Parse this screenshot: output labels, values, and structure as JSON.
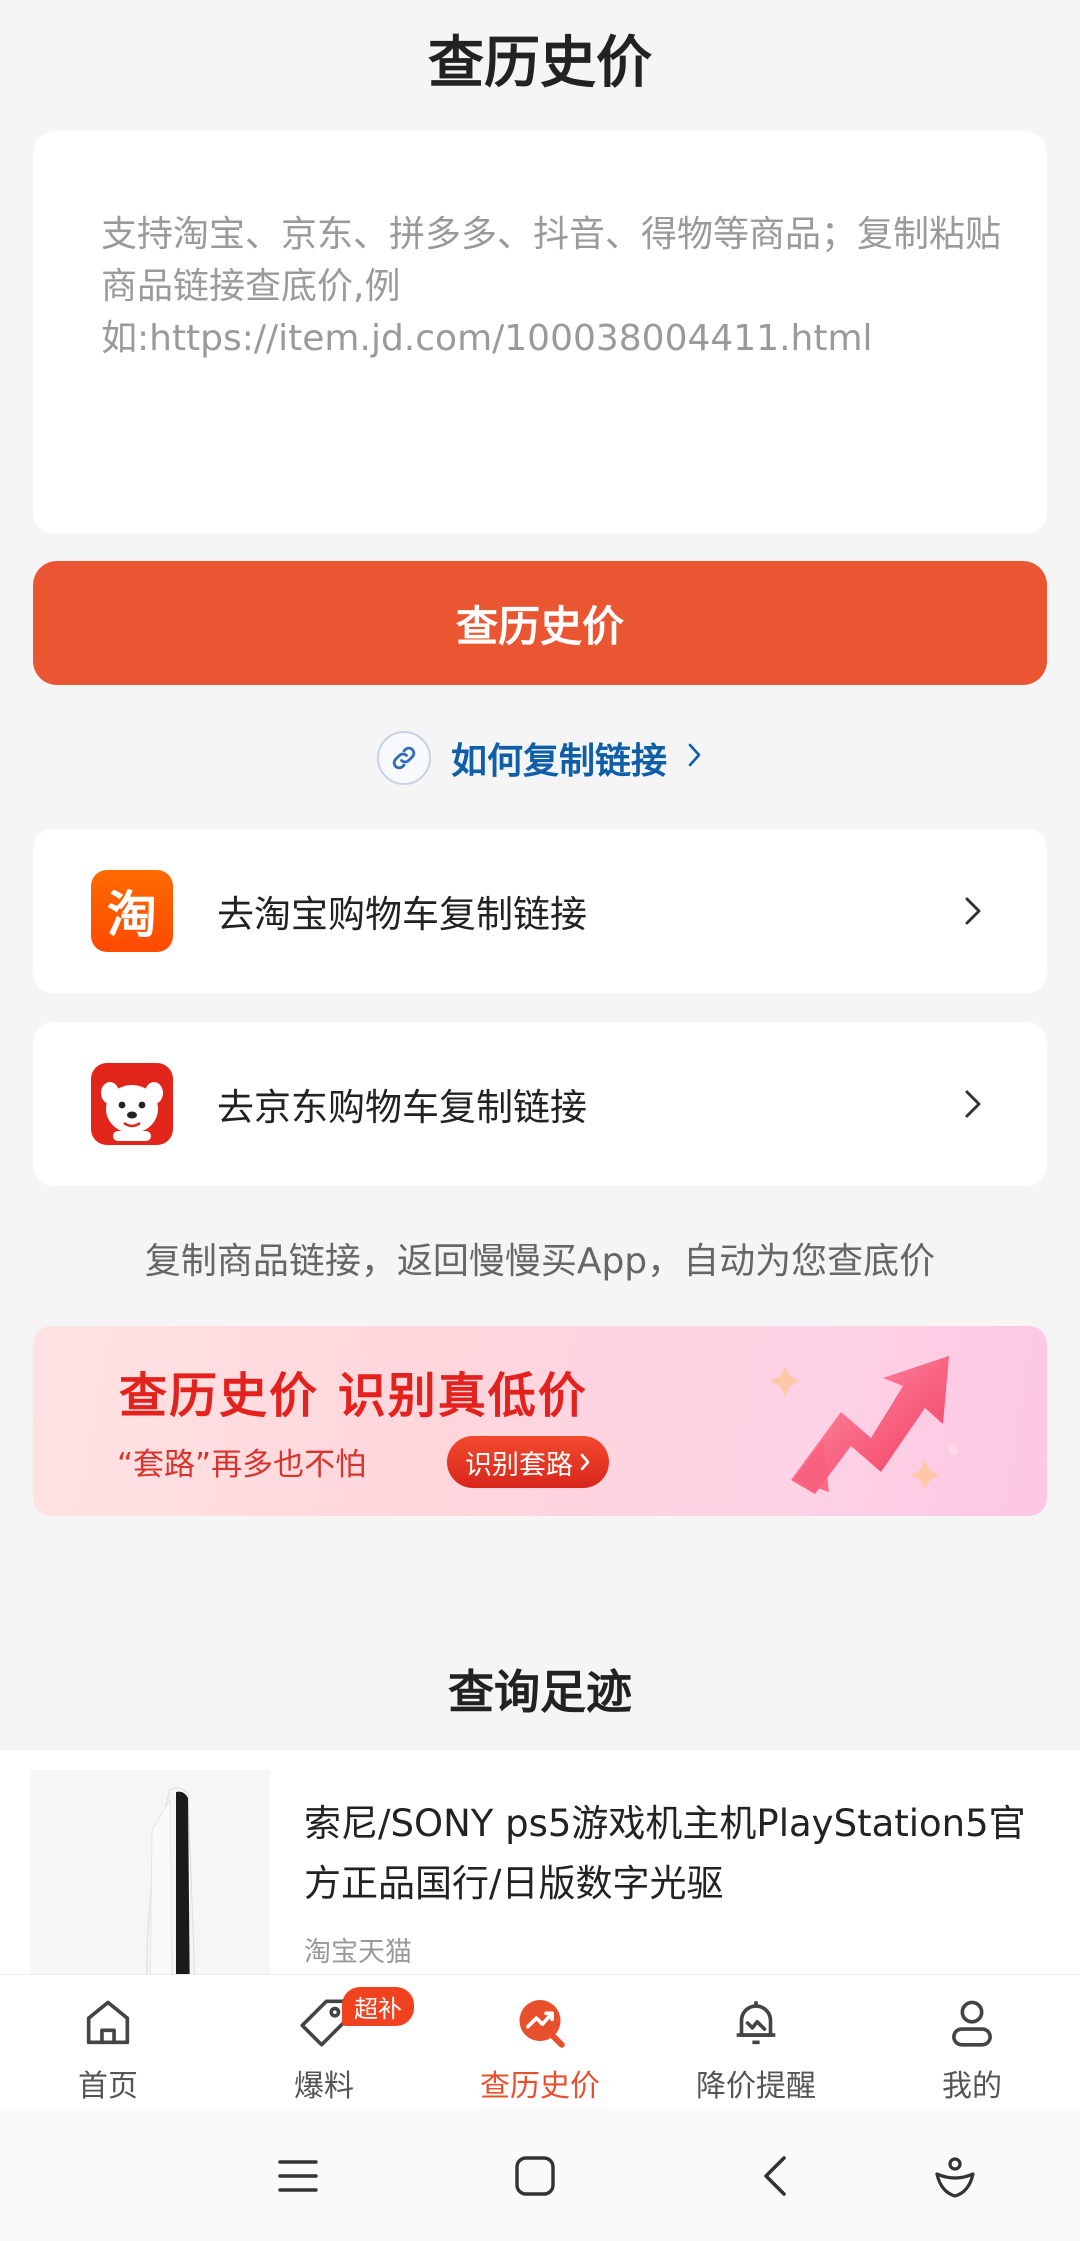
{
  "header": {
    "title": "查历史价"
  },
  "link_input": {
    "placeholder": "支持淘宝、京东、拼多多、抖音、得物等商品；复制粘贴商品链接查底价,例如:https://item.jd.com/100038004411.html"
  },
  "search_button": {
    "label": "查历史价"
  },
  "howto": {
    "label": "如何复制链接",
    "icon": "link-icon"
  },
  "shops": [
    {
      "logo_text": "淘",
      "label": "去淘宝购物车复制链接",
      "brand_color": "#ff5a00"
    },
    {
      "label": "去京东购物车复制链接",
      "brand_color": "#e1251b"
    }
  ],
  "hint": "复制商品链接，返回慢慢买App，自动为您查底价",
  "banner": {
    "title": "查历史价  识别真低价",
    "subtitle": "“套路”再多也不怕",
    "button_label": "识别套路"
  },
  "history": {
    "title": "查询足迹",
    "items": [
      {
        "name": "索尼/SONY ps5游戏机主机PlayStation5官方正品国行/日版数字光驱",
        "source": "淘宝天猫"
      }
    ]
  },
  "tabbar": {
    "items": [
      {
        "label": "首页",
        "icon": "home-icon"
      },
      {
        "label": "爆料",
        "icon": "tag-icon",
        "badge": "超补"
      },
      {
        "label": "查历史价",
        "icon": "price-trend-icon",
        "active": true
      },
      {
        "label": "降价提醒",
        "icon": "bell-icon"
      },
      {
        "label": "我的",
        "icon": "user-icon"
      }
    ],
    "active_color": "#e8502d"
  },
  "colors": {
    "accent": "#ea5532",
    "link": "#0e5ea8",
    "background": "#f5f5f5"
  }
}
